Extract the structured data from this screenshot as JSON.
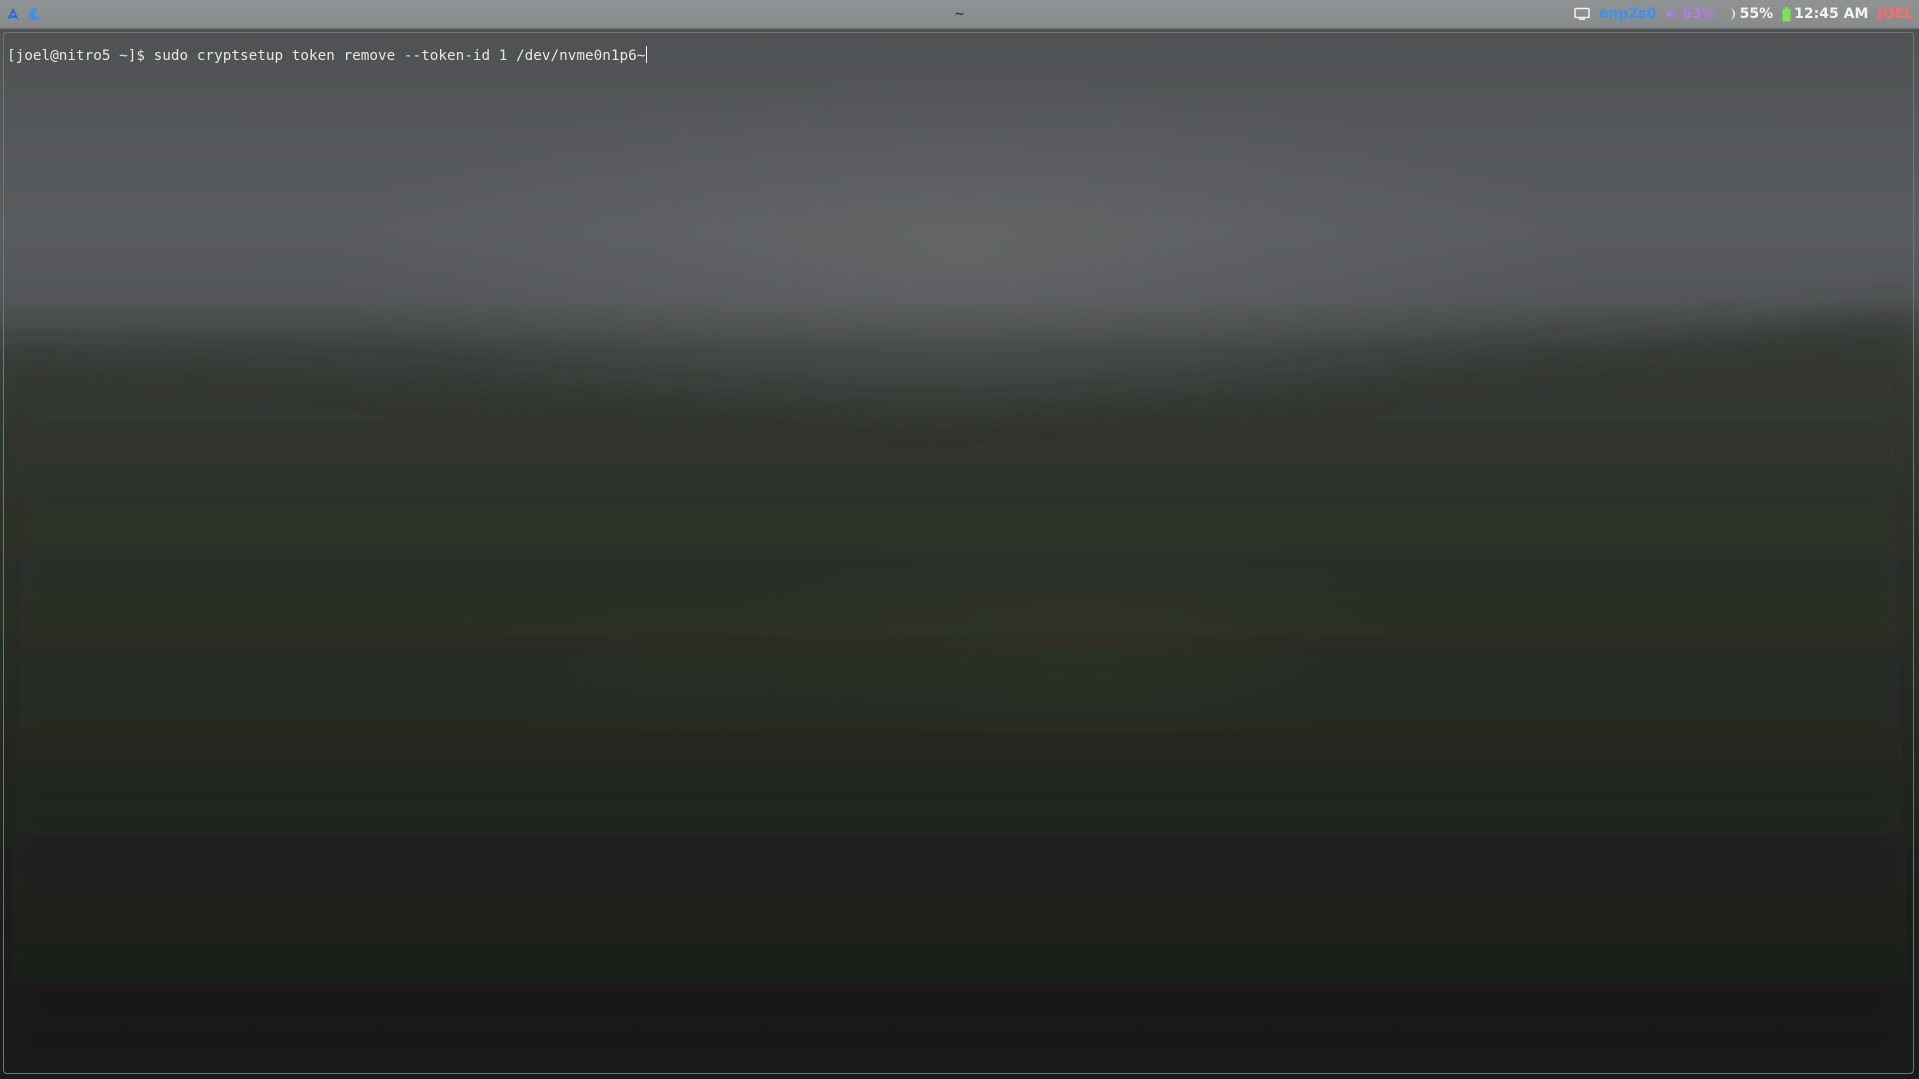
{
  "topbar": {
    "left_icons": [
      "arch-linux-icon",
      "moon-crescent-icon"
    ],
    "center_title": "~",
    "tray": {
      "network_label": "enp2s0",
      "volume_label": "63%",
      "brightness_label": "55%",
      "time_label": "12:45 AM",
      "user_label": "JOEL"
    },
    "colors": {
      "network": "#3d8ff0",
      "volume": "#b57be0",
      "brightness": "#f3f3f3",
      "battery": "#7ee05a",
      "time": "#f3f3f3",
      "user": "#ff6a6a"
    }
  },
  "terminal": {
    "prompt": "[joel@nitro5 ~]$ ",
    "command": "sudo cryptsetup token remove --token-id 1 /dev/nvme0n1p6~"
  }
}
